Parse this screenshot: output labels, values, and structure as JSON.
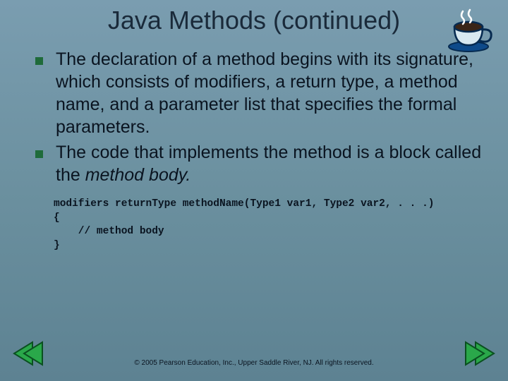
{
  "title": "Java Methods (continued)",
  "bullets": [
    {
      "text": "The declaration of a method begins with its signature, which consists of modifiers, a return type, a method name, and a parameter list that specifies the formal parameters."
    },
    {
      "text_pre": "The code that implements the method is a block called the ",
      "text_italic": "method body."
    }
  ],
  "code": {
    "line1": "modifiers returnType methodName(Type1 var1, Type2 var2, . . .)",
    "line2": "{",
    "line3": "    // method body",
    "line4": "}"
  },
  "footer": "© 2005 Pearson Education, Inc., Upper Saddle River, NJ.  All rights reserved.",
  "icons": {
    "coffee": "coffee-cup-icon",
    "prev": "arrow-left-icon",
    "next": "arrow-right-icon"
  }
}
